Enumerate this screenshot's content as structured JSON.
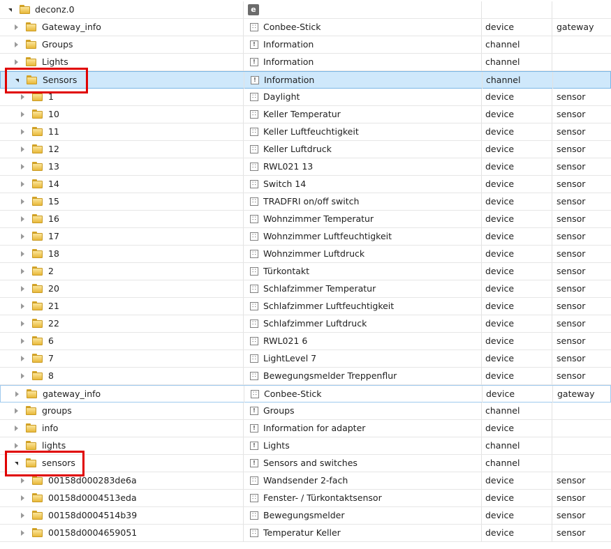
{
  "root": {
    "name": "deconz.0",
    "icon": "adapter-icon",
    "adapter_icon_glyph": "e"
  },
  "rows": [
    {
      "name": "Gateway_info",
      "desc": "Conbee-Stick",
      "type": "device",
      "role": "gateway",
      "level": 1,
      "expanded": false,
      "dicon": "dev"
    },
    {
      "name": "Groups",
      "desc": "Information",
      "type": "channel",
      "role": "",
      "level": 1,
      "expanded": false,
      "dicon": "chn"
    },
    {
      "name": "Lights",
      "desc": "Information",
      "type": "channel",
      "role": "",
      "level": 1,
      "expanded": false,
      "dicon": "chn"
    },
    {
      "name": "Sensors",
      "desc": "Information",
      "type": "channel",
      "role": "",
      "level": 1,
      "expanded": true,
      "dicon": "chn",
      "selected": true
    },
    {
      "name": "1",
      "desc": "Daylight",
      "type": "device",
      "role": "sensor",
      "level": 2,
      "expanded": false,
      "dicon": "dev"
    },
    {
      "name": "10",
      "desc": "Keller Temperatur",
      "type": "device",
      "role": "sensor",
      "level": 2,
      "expanded": false,
      "dicon": "dev"
    },
    {
      "name": "11",
      "desc": "Keller Luftfeuchtigkeit",
      "type": "device",
      "role": "sensor",
      "level": 2,
      "expanded": false,
      "dicon": "dev"
    },
    {
      "name": "12",
      "desc": "Keller Luftdruck",
      "type": "device",
      "role": "sensor",
      "level": 2,
      "expanded": false,
      "dicon": "dev"
    },
    {
      "name": "13",
      "desc": "RWL021 13",
      "type": "device",
      "role": "sensor",
      "level": 2,
      "expanded": false,
      "dicon": "dev"
    },
    {
      "name": "14",
      "desc": "Switch 14",
      "type": "device",
      "role": "sensor",
      "level": 2,
      "expanded": false,
      "dicon": "dev"
    },
    {
      "name": "15",
      "desc": "TRADFRI on/off switch",
      "type": "device",
      "role": "sensor",
      "level": 2,
      "expanded": false,
      "dicon": "dev"
    },
    {
      "name": "16",
      "desc": "Wohnzimmer Temperatur",
      "type": "device",
      "role": "sensor",
      "level": 2,
      "expanded": false,
      "dicon": "dev"
    },
    {
      "name": "17",
      "desc": "Wohnzimmer Luftfeuchtigkeit",
      "type": "device",
      "role": "sensor",
      "level": 2,
      "expanded": false,
      "dicon": "dev"
    },
    {
      "name": "18",
      "desc": "Wohnzimmer Luftdruck",
      "type": "device",
      "role": "sensor",
      "level": 2,
      "expanded": false,
      "dicon": "dev"
    },
    {
      "name": "2",
      "desc": "Türkontakt",
      "type": "device",
      "role": "sensor",
      "level": 2,
      "expanded": false,
      "dicon": "dev"
    },
    {
      "name": "20",
      "desc": "Schlafzimmer Temperatur",
      "type": "device",
      "role": "sensor",
      "level": 2,
      "expanded": false,
      "dicon": "dev"
    },
    {
      "name": "21",
      "desc": "Schlafzimmer Luftfeuchtigkeit",
      "type": "device",
      "role": "sensor",
      "level": 2,
      "expanded": false,
      "dicon": "dev"
    },
    {
      "name": "22",
      "desc": "Schlafzimmer Luftdruck",
      "type": "device",
      "role": "sensor",
      "level": 2,
      "expanded": false,
      "dicon": "dev"
    },
    {
      "name": "6",
      "desc": "RWL021 6",
      "type": "device",
      "role": "sensor",
      "level": 2,
      "expanded": false,
      "dicon": "dev"
    },
    {
      "name": "7",
      "desc": "LightLevel 7",
      "type": "device",
      "role": "sensor",
      "level": 2,
      "expanded": false,
      "dicon": "dev"
    },
    {
      "name": "8",
      "desc": "Bewegungsmelder Treppenflur",
      "type": "device",
      "role": "sensor",
      "level": 2,
      "expanded": false,
      "dicon": "dev"
    },
    {
      "name": "gateway_info",
      "desc": "Conbee-Stick",
      "type": "device",
      "role": "gateway",
      "level": 1,
      "expanded": false,
      "dicon": "dev",
      "hover": true
    },
    {
      "name": "groups",
      "desc": "Groups",
      "type": "channel",
      "role": "",
      "level": 1,
      "expanded": false,
      "dicon": "chn"
    },
    {
      "name": "info",
      "desc": "Information for adapter",
      "type": "device",
      "role": "",
      "level": 1,
      "expanded": false,
      "dicon": "chn"
    },
    {
      "name": "lights",
      "desc": "Lights",
      "type": "channel",
      "role": "",
      "level": 1,
      "expanded": false,
      "dicon": "chn"
    },
    {
      "name": "sensors",
      "desc": "Sensors and switches",
      "type": "channel",
      "role": "",
      "level": 1,
      "expanded": true,
      "dicon": "chn"
    },
    {
      "name": "00158d000283de6a",
      "desc": "Wandsender 2-fach",
      "type": "device",
      "role": "sensor",
      "level": 2,
      "expanded": false,
      "dicon": "dev"
    },
    {
      "name": "00158d0004513eda",
      "desc": "Fenster- / Türkontaktsensor",
      "type": "device",
      "role": "sensor",
      "level": 2,
      "expanded": false,
      "dicon": "dev"
    },
    {
      "name": "00158d0004514b39",
      "desc": "Bewegungsmelder",
      "type": "device",
      "role": "sensor",
      "level": 2,
      "expanded": false,
      "dicon": "dev"
    },
    {
      "name": "00158d0004659051",
      "desc": "Temperatur Keller",
      "type": "device",
      "role": "sensor",
      "level": 2,
      "expanded": false,
      "dicon": "dev"
    }
  ],
  "colors": {
    "selected_row": "#cfe8fb",
    "highlight_box": "#e00000",
    "folder": "#f2cf5b"
  }
}
